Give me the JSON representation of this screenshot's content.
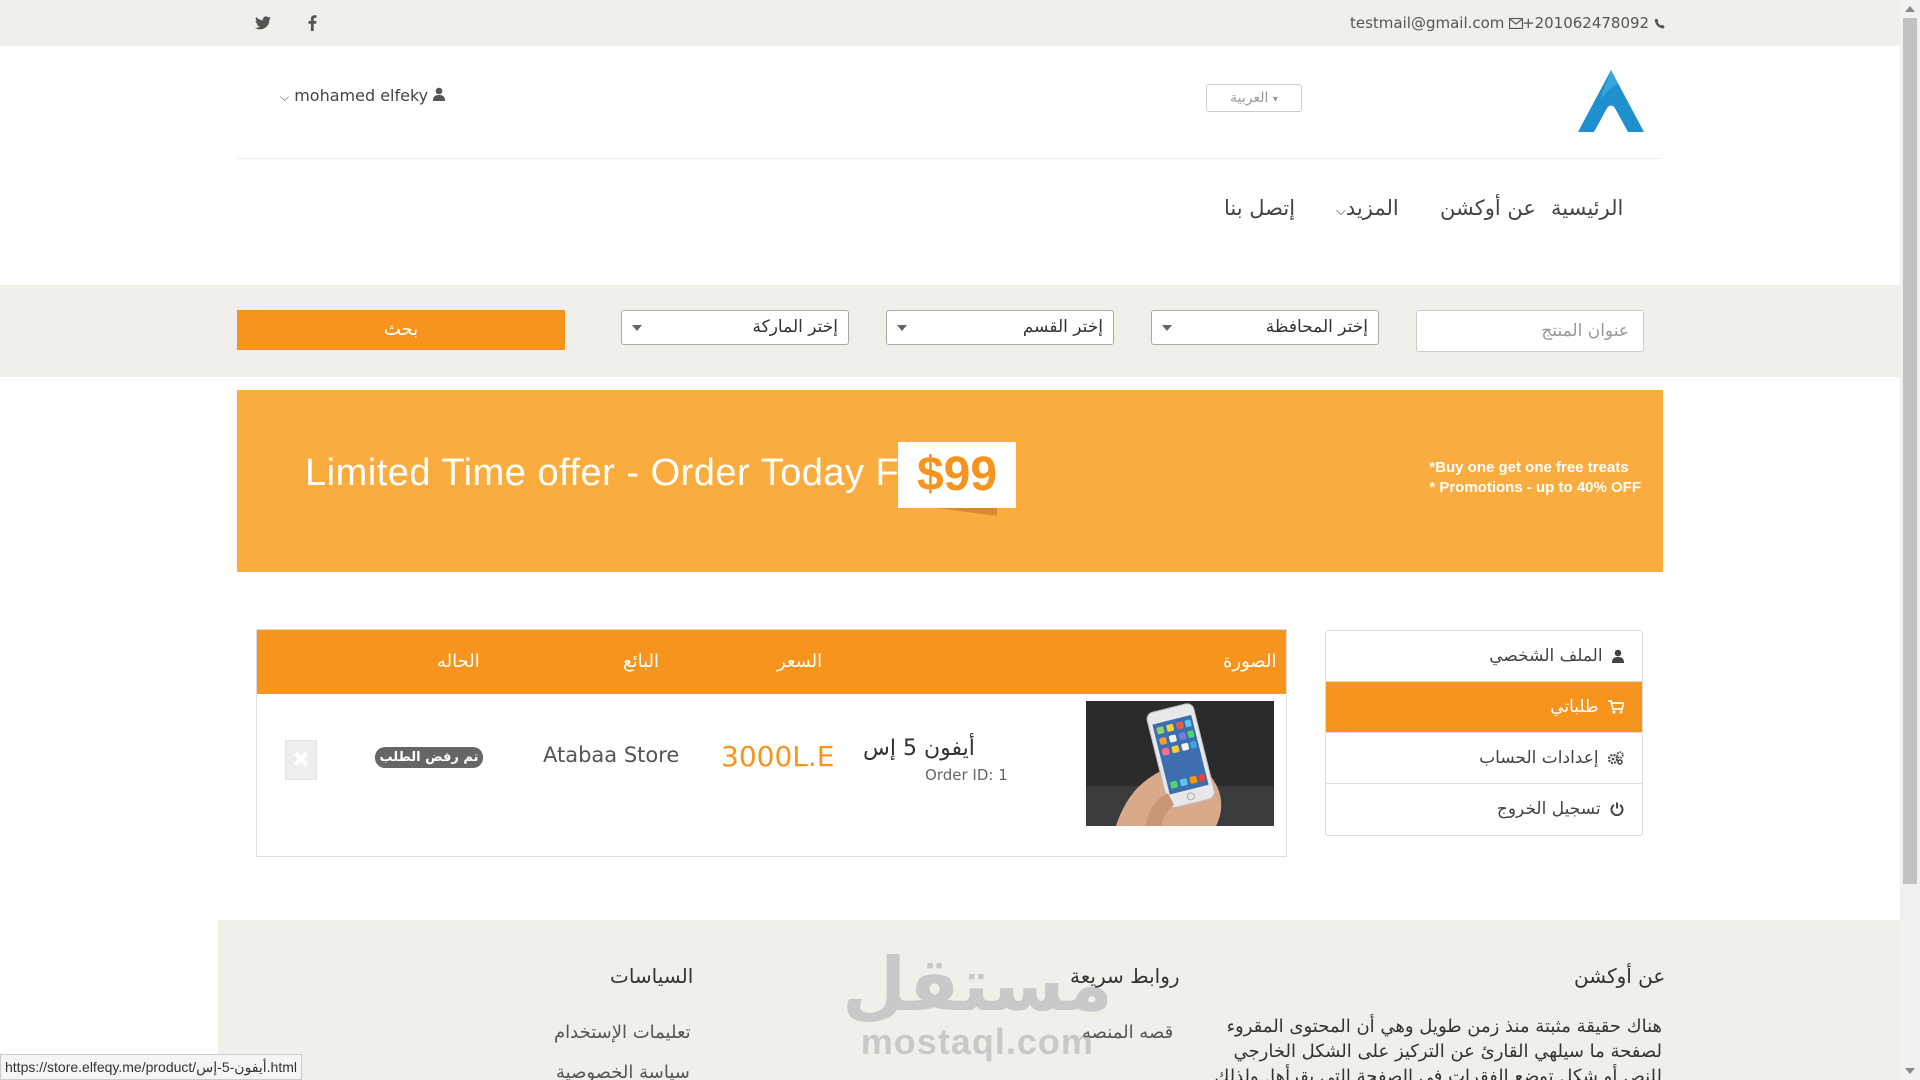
{
  "topbar": {
    "phone": "+201062478092",
    "email": "testmail@gmail.com",
    "social": [
      "twitter-icon",
      "facebook-icon"
    ]
  },
  "header": {
    "language": "العربية",
    "user_name": "mohamed elfeky"
  },
  "nav": {
    "items": [
      "الرئيسية",
      "عن أوكشن",
      "المزيد",
      "إتصل بنا"
    ]
  },
  "search": {
    "title_placeholder": "عنوان المنتج",
    "governorate": "إختر المحافظة",
    "category": "إختر القسم",
    "brand": "إختر الماركة",
    "button": "بحث"
  },
  "banner": {
    "headline": "Limited Time offer - Order Today For",
    "price": "$99",
    "note1": "*Buy one get one free treats",
    "note2": "* Promotions - up to 40% OFF"
  },
  "sidebar": {
    "items": [
      {
        "label": "الملف الشخصي",
        "icon": "user-icon",
        "active": false
      },
      {
        "label": "طلباتي",
        "icon": "cart-icon",
        "active": true
      },
      {
        "label": "إعدادات الحساب",
        "icon": "gears-icon",
        "active": false
      },
      {
        "label": "تسجيل الخروج",
        "icon": "power-icon",
        "active": false
      }
    ]
  },
  "orders": {
    "headers": {
      "image": "الصورة",
      "price": "السعر",
      "seller": "البائع",
      "status": "الحاله"
    },
    "rows": [
      {
        "product": "أيفون 5 إس",
        "order_id": "Order ID: 1",
        "price": "3000L.E",
        "seller": "Atabaa Store",
        "status": "تم رفض الطلب",
        "delete_icon": "close-icon"
      }
    ]
  },
  "footer": {
    "about_title": "عن أوكشن",
    "about_text": "هناك حقيقة مثبتة منذ زمن طويل وهي أن المحتوى المقروء لصفحة ما سيلهي القارئ عن التركيز على الشكل الخارجي للنص أو شكل توضع الفقرات في الصفحة التي يقرأها. ولذلك يتم",
    "quick_title": "روابط سريعة",
    "quick_links": [
      "قصه المنصه"
    ],
    "policies_title": "السياسات",
    "policies_links": [
      "تعليمات الإستخدام",
      "سياسة الخصوصية"
    ],
    "watermark_ar": "مستقل",
    "watermark_en": "mostaql.com"
  },
  "status_url": "https://store.elfeqy.me/product/أيفون-5-إس.html",
  "colors": {
    "accent": "#f7941d",
    "banner": "#fbac3e",
    "band": "#f0efea"
  }
}
